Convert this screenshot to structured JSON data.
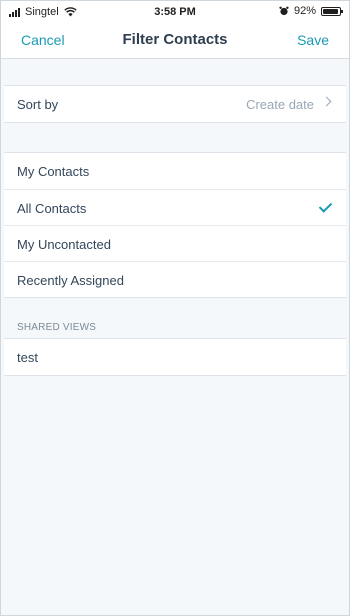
{
  "status_bar": {
    "carrier": "Singtel",
    "time": "3:58 PM",
    "battery_percent": "92%",
    "battery_level": 0.92,
    "icons": [
      "signal-bars-icon",
      "wifi-icon",
      "alarm-icon",
      "battery-icon"
    ]
  },
  "nav": {
    "cancel_label": "Cancel",
    "title": "Filter Contacts",
    "save_label": "Save"
  },
  "sort": {
    "label": "Sort by",
    "value": "Create date"
  },
  "views": {
    "items": [
      {
        "label": "My Contacts",
        "selected": false
      },
      {
        "label": "All Contacts",
        "selected": true
      },
      {
        "label": "My Uncontacted",
        "selected": false
      },
      {
        "label": "Recently Assigned",
        "selected": false
      }
    ]
  },
  "shared_views": {
    "header": "SHARED VIEWS",
    "items": [
      {
        "label": "test"
      }
    ]
  },
  "colors": {
    "accent": "#1a9bb5",
    "background": "#f5f8fa",
    "text": "#33475b",
    "muted": "#9aa7b4"
  }
}
